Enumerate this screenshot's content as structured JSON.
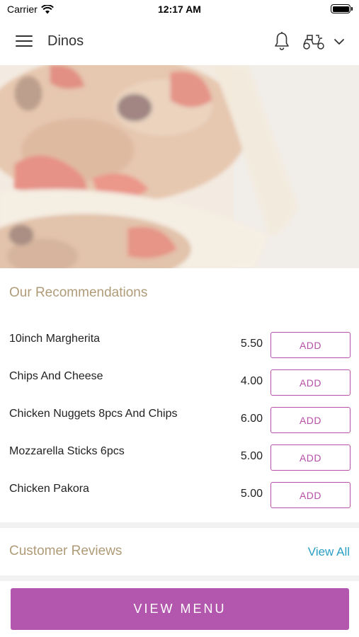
{
  "status_bar": {
    "carrier": "Carrier",
    "time": "12:17 AM"
  },
  "header": {
    "title": "Dinos",
    "icons": [
      "menu-icon",
      "bell-icon",
      "scooter-icon",
      "chevron-down-icon"
    ]
  },
  "hero": {
    "image": "chicken-wrap-photo"
  },
  "recommendations": {
    "title": "Our Recommendations",
    "items": [
      {
        "name": "10inch Margherita",
        "price": "5.50",
        "button": "ADD"
      },
      {
        "name": "Chips And Cheese",
        "price": "4.00",
        "button": "ADD"
      },
      {
        "name": "Chicken Nuggets 8pcs And Chips",
        "price": "6.00",
        "button": "ADD"
      },
      {
        "name": "Mozzarella Sticks 6pcs",
        "price": "5.00",
        "button": "ADD"
      },
      {
        "name": "Chicken Pakora",
        "price": "5.00",
        "button": "ADD"
      }
    ]
  },
  "reviews": {
    "title": "Customer Reviews",
    "view_all": "View All"
  },
  "footer": {
    "view_menu": "VIEW MENU"
  },
  "colors": {
    "accent": "#b356ad",
    "section_title": "#b09b78",
    "link": "#2a9fc4"
  }
}
